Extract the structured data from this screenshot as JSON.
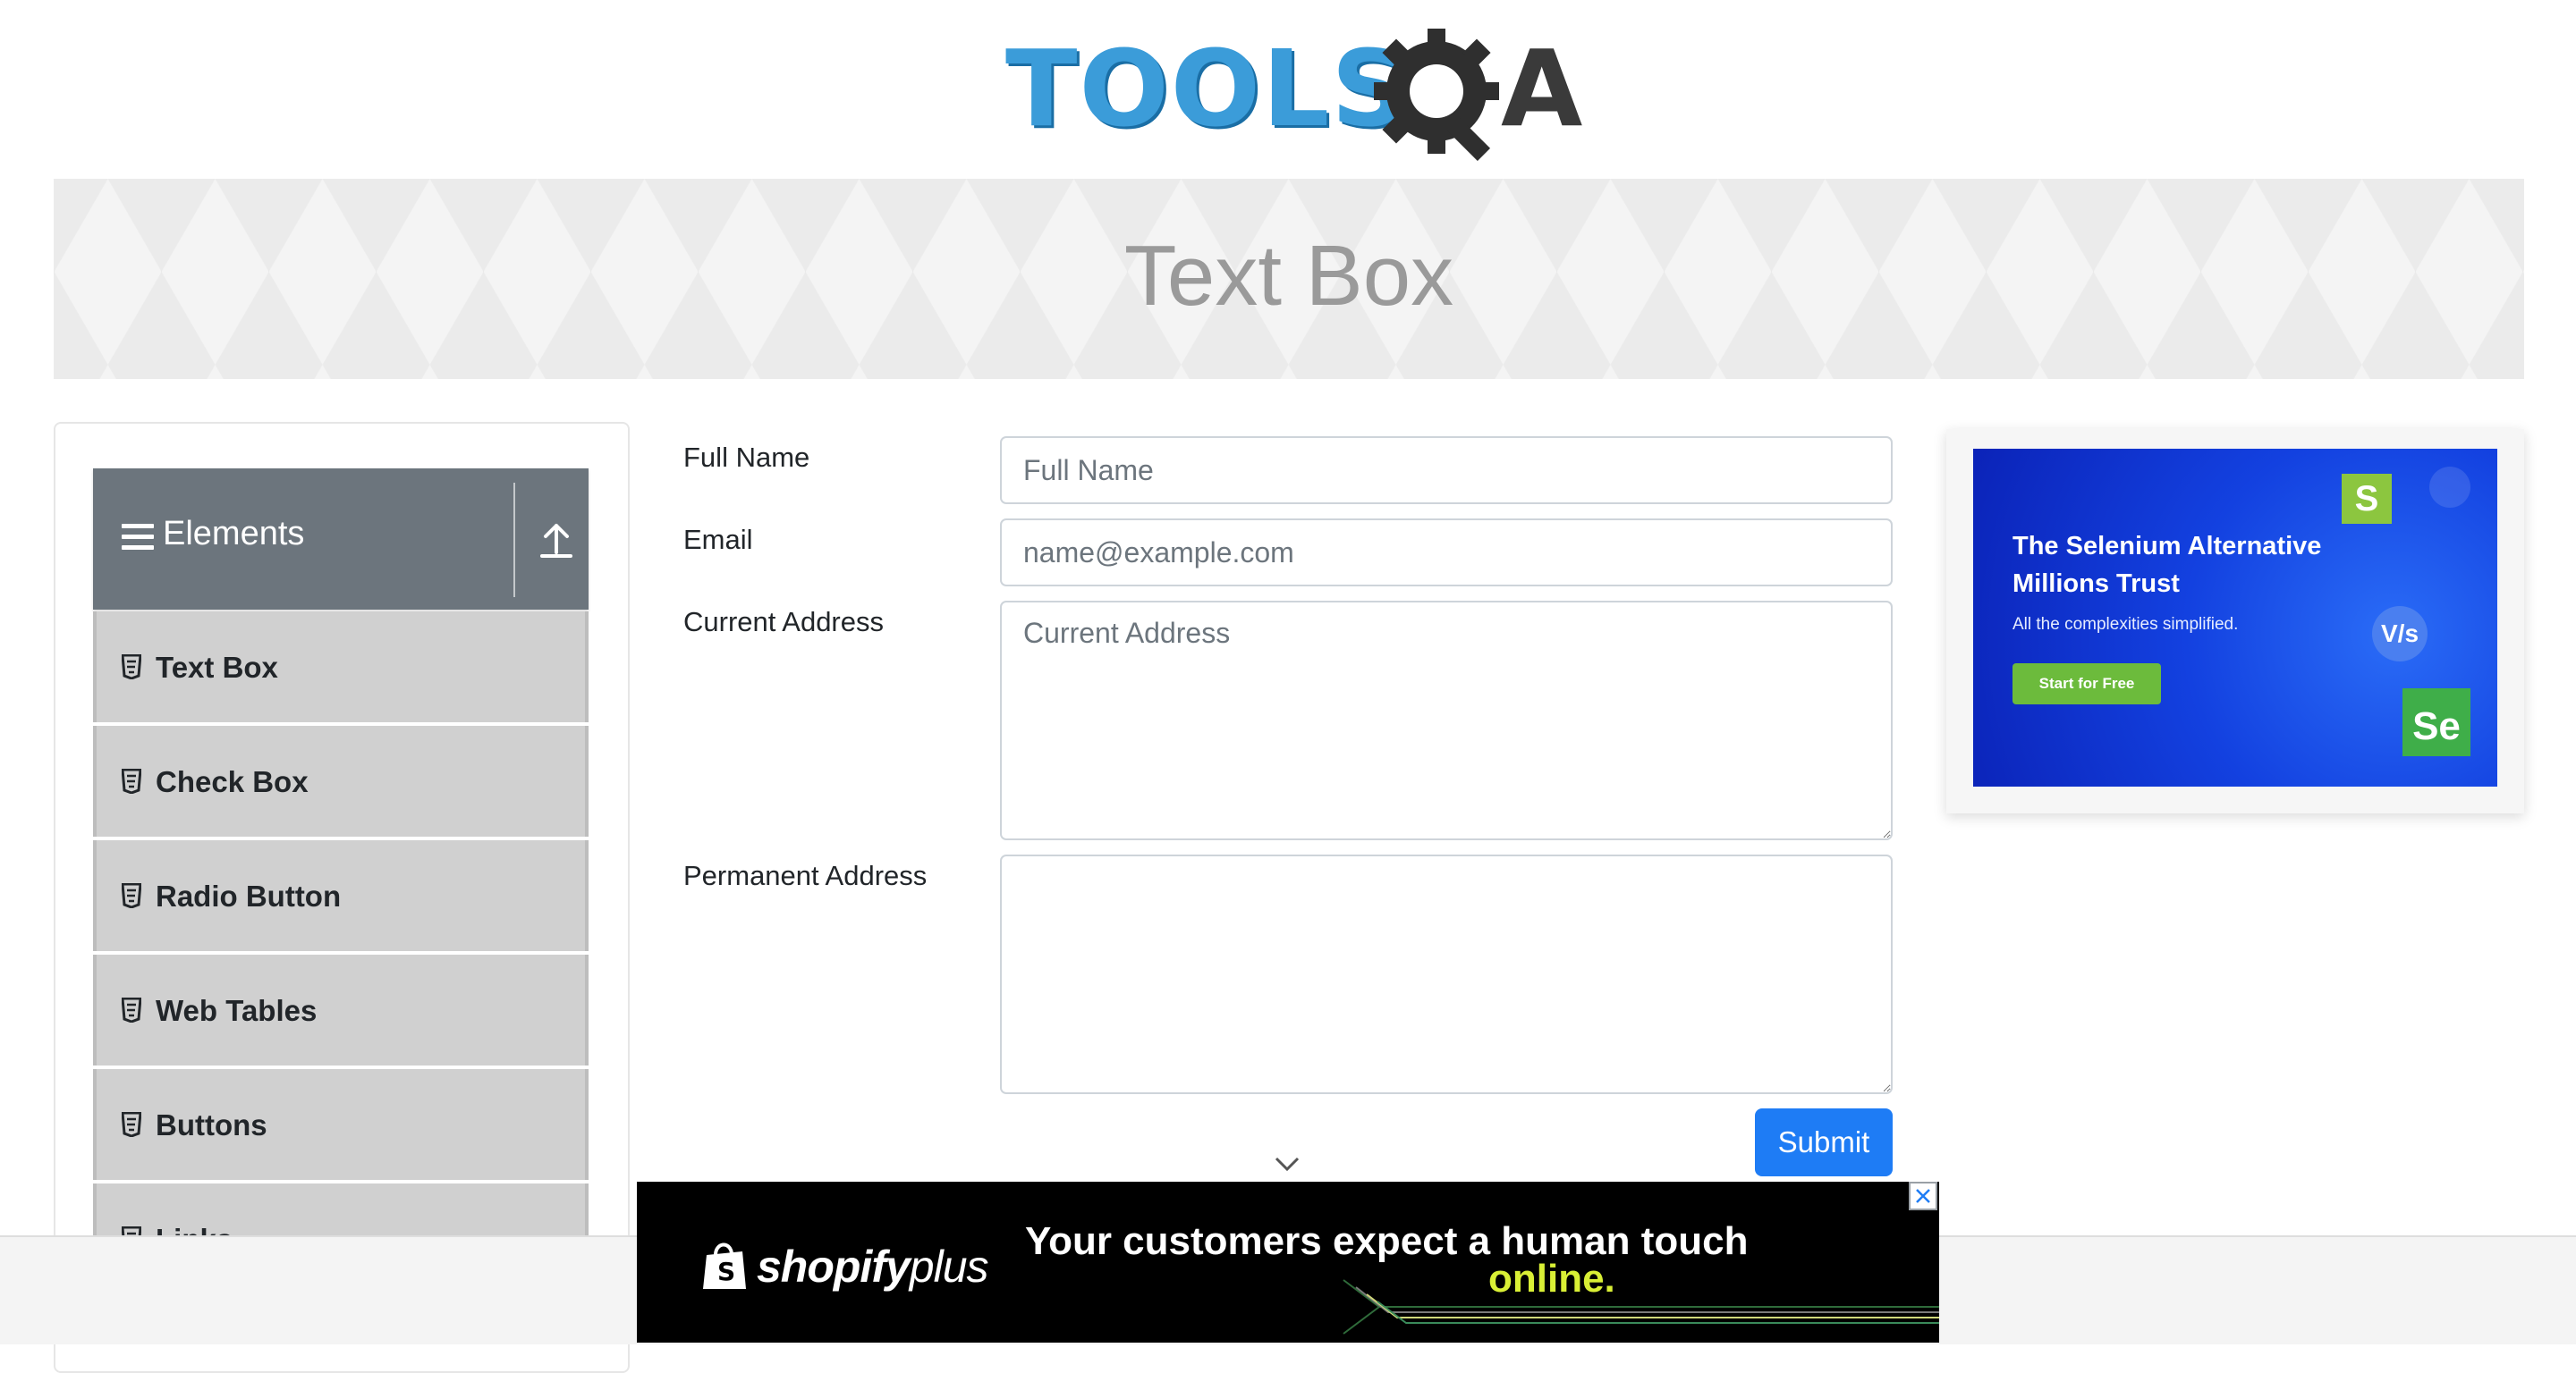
{
  "brand": {
    "logo_text": "TOOLS",
    "logo_suffix": "A"
  },
  "page": {
    "title": "Text Box"
  },
  "sidebar": {
    "group_title": "Elements",
    "items": [
      {
        "label": "Text Box"
      },
      {
        "label": "Check Box"
      },
      {
        "label": "Radio Button"
      },
      {
        "label": "Web Tables"
      },
      {
        "label": "Buttons"
      },
      {
        "label": "Links"
      }
    ]
  },
  "form": {
    "full_name": {
      "label": "Full Name",
      "placeholder": "Full Name",
      "value": ""
    },
    "email": {
      "label": "Email",
      "placeholder": "name@example.com",
      "value": ""
    },
    "current_address": {
      "label": "Current Address",
      "placeholder": "Current Address",
      "value": ""
    },
    "permanent_address": {
      "label": "Permanent Address",
      "placeholder": "",
      "value": ""
    },
    "submit_label": "Submit"
  },
  "side_ad": {
    "title": "The Selenium Alternative Millions Trust",
    "subtitle": "All the complexities simplified.",
    "cta": "Start for Free",
    "badge_s": "S",
    "badge_vs": "V/s",
    "badge_se": "Se"
  },
  "bottom_ad": {
    "brand": "shopify",
    "brand_suffix": "plus",
    "headline": "Your customers expect a human touch",
    "headline_accent": "online."
  },
  "colors": {
    "primary": "#1e7cf5",
    "sidebar_header": "#6c757d",
    "menu_item_bg": "#d0d0d0",
    "logo_blue": "#3b9cd9",
    "ad_accent": "#d9ef35"
  },
  "icons": {
    "menu": "hamburger-icon",
    "collapse": "upload-arrow-icon",
    "item": "html5-shield-icon",
    "scroll_hint": "chevron-down-icon",
    "close": "close-icon"
  }
}
